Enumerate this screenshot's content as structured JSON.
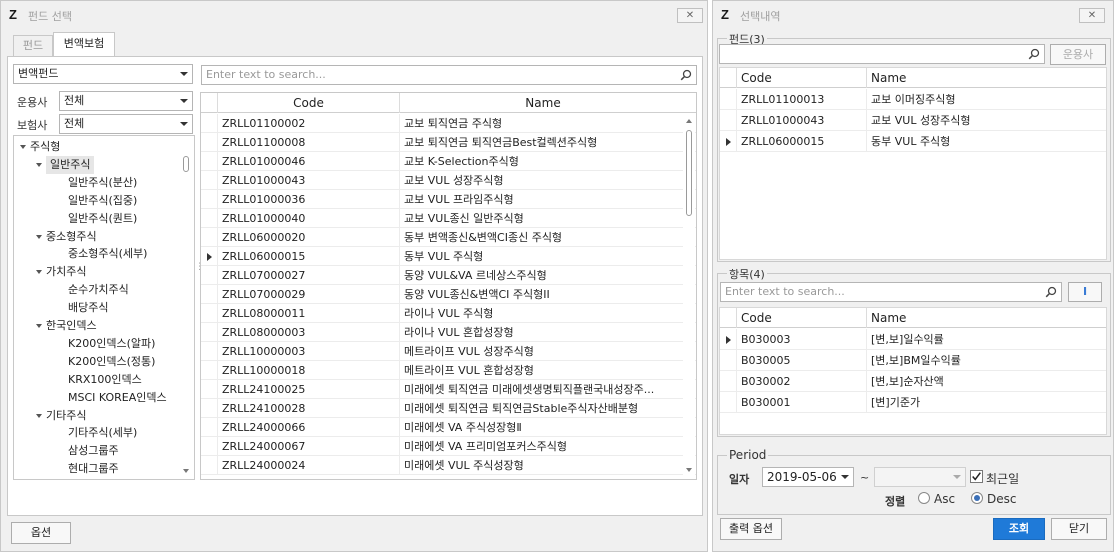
{
  "left_window": {
    "title": "펀드 선택",
    "close_label": "✕",
    "tabs": [
      "펀드",
      "변액보험"
    ],
    "fund_type": "변액펀드",
    "search_placeholder": "Enter text to search...",
    "filters": [
      {
        "label": "운용사",
        "value": "전체"
      },
      {
        "label": "보험사",
        "value": "전체"
      }
    ],
    "tree": [
      {
        "label": "주식형",
        "level": 0,
        "expanded": true
      },
      {
        "label": "일반주식",
        "level": 1,
        "expanded": true,
        "selected": true
      },
      {
        "label": "일반주식(분산)",
        "level": 2
      },
      {
        "label": "일반주식(집중)",
        "level": 2
      },
      {
        "label": "일반주식(퀀트)",
        "level": 2
      },
      {
        "label": "중소형주식",
        "level": 1,
        "expanded": true
      },
      {
        "label": "중소형주식(세부)",
        "level": 2
      },
      {
        "label": "가치주식",
        "level": 1,
        "expanded": true
      },
      {
        "label": "순수가치주식",
        "level": 2
      },
      {
        "label": "배당주식",
        "level": 2
      },
      {
        "label": "한국인덱스",
        "level": 1,
        "expanded": true
      },
      {
        "label": "K200인덱스(알파)",
        "level": 2
      },
      {
        "label": "K200인덱스(정통)",
        "level": 2
      },
      {
        "label": "KRX100인덱스",
        "level": 2
      },
      {
        "label": "MSCI KOREA인덱스",
        "level": 2
      },
      {
        "label": "기타주식",
        "level": 1,
        "expanded": true
      },
      {
        "label": "기타주식(세부)",
        "level": 2
      },
      {
        "label": "삼성그룹주",
        "level": 2
      },
      {
        "label": "현대그룹주",
        "level": 2
      }
    ],
    "grid": {
      "columns": [
        "Code",
        "Name"
      ],
      "current_row": 7,
      "rows": [
        [
          "ZRLL01100002",
          "교보 퇴직연금 주식형"
        ],
        [
          "ZRLL01100008",
          "교보 퇴직연금 퇴직연금Best컬렉션주식형"
        ],
        [
          "ZRLL01000046",
          "교보 K-Selection주식형"
        ],
        [
          "ZRLL01000043",
          "교보 VUL 성장주식형"
        ],
        [
          "ZRLL01000036",
          "교보 VUL 프라임주식형"
        ],
        [
          "ZRLL01000040",
          "교보 VUL종신 일반주식형"
        ],
        [
          "ZRLL06000020",
          "동부 변액종신&변액CI종신 주식형"
        ],
        [
          "ZRLL06000015",
          "동부 VUL 주식형"
        ],
        [
          "ZRLL07000027",
          "동양 VUL&VA 르네상스주식형"
        ],
        [
          "ZRLL07000029",
          "동양 VUL종신&변액CI 주식형II"
        ],
        [
          "ZRLL08000011",
          "라이나 VUL 주식형"
        ],
        [
          "ZRLL08000003",
          "라이나 VUL 혼합성장형"
        ],
        [
          "ZRLL10000003",
          "메트라이프 VUL 성장주식형"
        ],
        [
          "ZRLL10000018",
          "메트라이프 VUL 혼합성장형"
        ],
        [
          "ZRLL24100025",
          "미래에셋 퇴직연금 미래에셋생명퇴직플랜국내성장주..."
        ],
        [
          "ZRLL24100028",
          "미래에셋 퇴직연금 퇴직연금Stable주식자산배분형"
        ],
        [
          "ZRLL24000066",
          "미래에셋 VA 주식성장형Ⅱ"
        ],
        [
          "ZRLL24000067",
          "미래에셋 VA 프리미엄포커스주식형"
        ],
        [
          "ZRLL24000024",
          "미래에셋 VUL 주식성장형"
        ]
      ]
    },
    "options_button": "옵션"
  },
  "right_window": {
    "title": "선택내역",
    "close_label": "✕",
    "funds_group": {
      "title": "펀드(3)",
      "search_button": "운용사",
      "columns": [
        "Code",
        "Name"
      ],
      "current_row": 2,
      "rows": [
        [
          "ZRLL01100013",
          "교보 이머징주식형"
        ],
        [
          "ZRLL01000043",
          "교보 VUL 성장주식형"
        ],
        [
          "ZRLL06000015",
          "동부 VUL 주식형"
        ]
      ]
    },
    "items_group": {
      "title": "항목(4)",
      "search_placeholder": "Enter text to search...",
      "columns": [
        "Code",
        "Name"
      ],
      "current_row": 0,
      "rows": [
        [
          "B030003",
          "[변,보]일수익률"
        ],
        [
          "B030005",
          "[변,보]BM일수익률"
        ],
        [
          "B030002",
          "[변,보]순자산액"
        ],
        [
          "B030001",
          "[변]기준가"
        ]
      ]
    },
    "period": {
      "title": "Period",
      "date_label": "일자",
      "date_value": "2019-05-06",
      "tilde": "~",
      "recent_label": "최근일",
      "recent_checked": true,
      "sort_label": "정렬",
      "asc_label": "Asc",
      "desc_label": "Desc",
      "sort_value": "Desc"
    },
    "output_options_button": "출력 옵션",
    "query_button": "조회",
    "close_button": "닫기"
  }
}
